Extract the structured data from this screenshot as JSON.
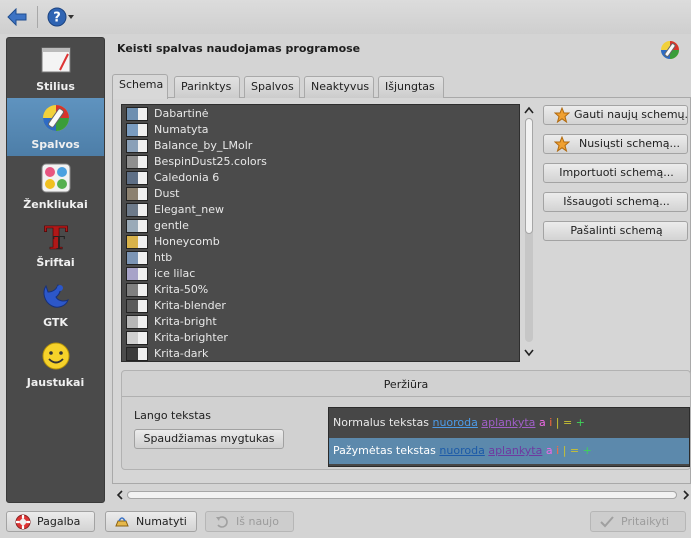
{
  "toolbar": {
    "back_icon": "back-arrow-icon",
    "help_icon": "help-icon"
  },
  "sidebar": {
    "items": [
      {
        "label": "Stilius",
        "icon": "style-icon",
        "active": false
      },
      {
        "label": "Spalvos",
        "icon": "colors-icon",
        "active": true
      },
      {
        "label": "Ženkliukai",
        "icon": "emblems-icon",
        "active": false
      },
      {
        "label": "Šriftai",
        "icon": "fonts-icon",
        "active": false
      },
      {
        "label": "GTK",
        "icon": "gtk-icon",
        "active": false
      },
      {
        "label": "Jaustukai",
        "icon": "emoticons-icon",
        "active": false
      }
    ]
  },
  "header": {
    "title": "Keisti spalvas naudojamas programose"
  },
  "tabs": [
    {
      "label": "Schema",
      "active": true
    },
    {
      "label": "Parinktys",
      "active": false
    },
    {
      "label": "Spalvos",
      "active": false
    },
    {
      "label": "Neaktyvus",
      "active": false
    },
    {
      "label": "Išjungtas",
      "active": false
    }
  ],
  "schemes": [
    {
      "name": "Dabartinė",
      "swatch": "#6e8fb0"
    },
    {
      "name": "Numatyta",
      "swatch": "#7a9cc0"
    },
    {
      "name": "Balance_by_LMolr",
      "swatch": "#8aa0b8"
    },
    {
      "name": "BespinDust25.colors",
      "swatch": "#8f8f8f"
    },
    {
      "name": "Caledonia 6",
      "swatch": "#5e6f86"
    },
    {
      "name": "Dust",
      "swatch": "#8c8170"
    },
    {
      "name": "Elegant_new",
      "swatch": "#6d7a8a"
    },
    {
      "name": "gentle",
      "swatch": "#9aaab8"
    },
    {
      "name": "Honeycomb",
      "swatch": "#d8b24a"
    },
    {
      "name": "htb",
      "swatch": "#7c95b5"
    },
    {
      "name": "ice lilac",
      "swatch": "#a7a3c8"
    },
    {
      "name": "Krita-50%",
      "swatch": "#7f7f7f"
    },
    {
      "name": "Krita-blender",
      "swatch": "#5b5b5b"
    },
    {
      "name": "Krita-bright",
      "swatch": "#b7b7b7"
    },
    {
      "name": "Krita-brighter",
      "swatch": "#cfcfcf"
    },
    {
      "name": "Krita-dark",
      "swatch": "#3c3c3c"
    }
  ],
  "actions": {
    "get_new": "Gauti naujų schemų...",
    "download": "Nusiųsti schemą...",
    "import": "Importuoti schemą...",
    "save": "Išsaugoti schemą...",
    "remove": "Pašalinti schemą"
  },
  "preview": {
    "title": "Peržiūra",
    "window_text": "Lango tekstas",
    "push_button": "Spaudžiamas mygtukas",
    "normal_text": "Normalus tekstas",
    "selected_text": "Pažymėtas tekstas",
    "link": "nuoroda",
    "visited": "aplankyta",
    "a": "a",
    "i": "i",
    "n": "|",
    "eq": "=",
    "p": "+"
  },
  "footer": {
    "help": "Pagalba",
    "defaults": "Numatyti",
    "reset": "Iš naujo",
    "apply": "Pritaikyti"
  },
  "colors": {
    "accent": "#5f93bf",
    "sidebar_bg": "#4a4a4a",
    "list_bg": "#4b4b4b"
  }
}
